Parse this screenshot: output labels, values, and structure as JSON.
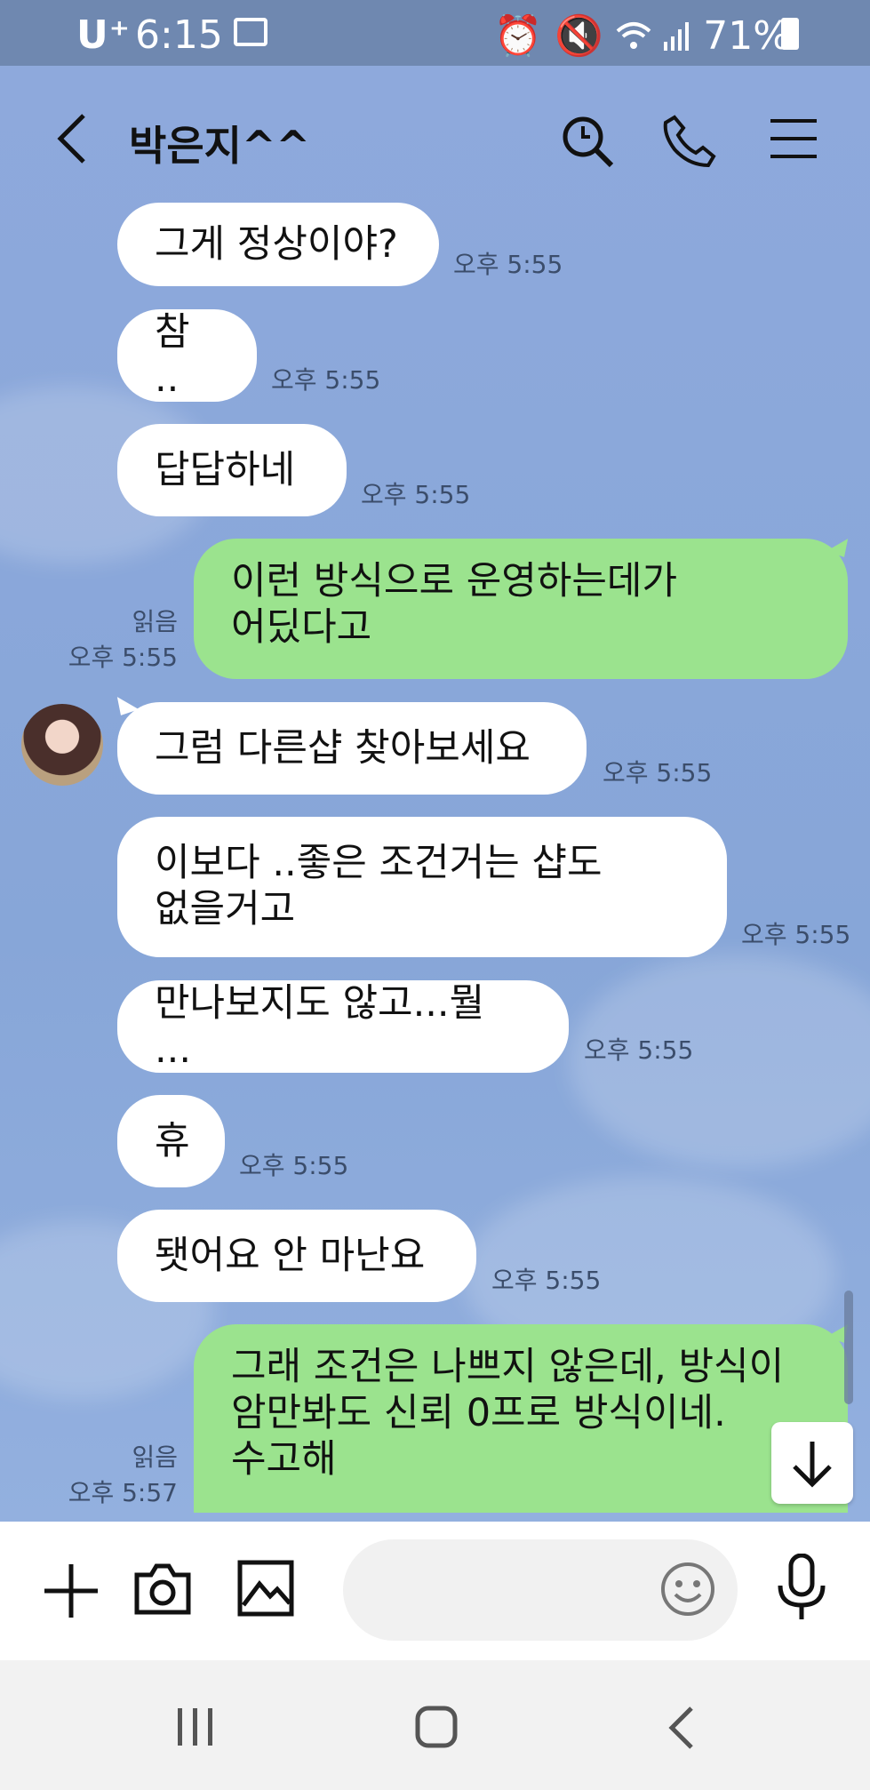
{
  "status_bar": {
    "carrier": "U⁺",
    "time": "6:15",
    "battery": "71%"
  },
  "header": {
    "title": "박은지^^"
  },
  "messages": [
    {
      "text": "그게 정상이야?",
      "time": "오후 5:55"
    },
    {
      "text": "참 ..",
      "time": "오후 5:55"
    },
    {
      "text": "답답하네",
      "time": "오후 5:55"
    },
    {
      "line1": "이런 방식으로 운영하는데가",
      "line2": "어딨다고",
      "read": "읽음",
      "time": "오후 5:55"
    },
    {
      "text": "그럼 다른샵 찾아보세요",
      "time": "오후 5:55"
    },
    {
      "line1": "이보다 ..좋은 조건거는 샵도",
      "line2": "없을거고",
      "time": "오후 5:55"
    },
    {
      "text": "만나보지도 않고...뭘 ...",
      "time": "오후 5:55"
    },
    {
      "text": "휴",
      "time": "오후 5:55"
    },
    {
      "text": "됏어요 안 마난요",
      "time": "오후 5:55"
    },
    {
      "line1": "그래 조건은 나쁘지 않은데, 방식이",
      "line2": "암만봐도 신뢰 0프로 방식이네.",
      "line3": "수고해",
      "read": "읽음",
      "time": "오후 5:57"
    }
  ],
  "input": {
    "placeholder": ""
  }
}
